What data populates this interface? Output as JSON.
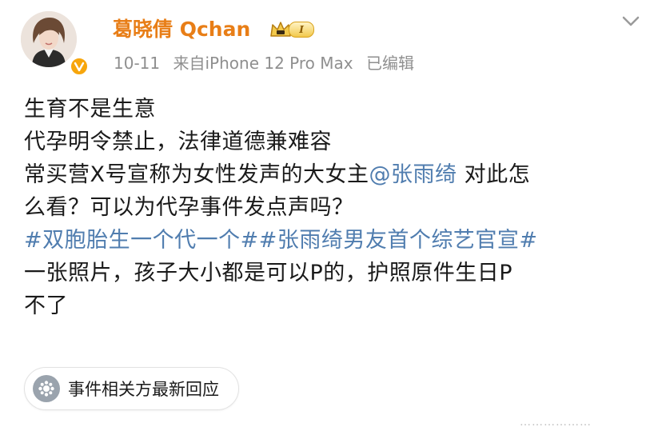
{
  "author": {
    "name": "葛晓倩 Qchan",
    "level_badge": "I",
    "verified_color": "#f7a60c",
    "name_color": "#e87e17"
  },
  "meta": {
    "date": "10-11",
    "source": "来自iPhone 12 Pro Max",
    "edited": "已编辑"
  },
  "post": {
    "line1": "生育不是生意",
    "line2": "代孕明令禁止，法律道德兼难容",
    "line3_prefix": "常买营X号宣称为女性发声的大女主",
    "mention": "@张雨绮",
    "line3_suffix": " 对此怎",
    "line4": "么看？可以为代孕事件发点声吗？",
    "hashtag1": "#双胞胎生一个代一个#",
    "hashtag2": "#张雨绮男友首个综艺官宣#",
    "line6": "一张照片，孩子大小都是可以P的，护照原件生日P",
    "line7": "不了",
    "link_color": "#507daf"
  },
  "related": {
    "label": "事件相关方最新回应",
    "icon": "event-icon"
  },
  "watermark": "………………"
}
